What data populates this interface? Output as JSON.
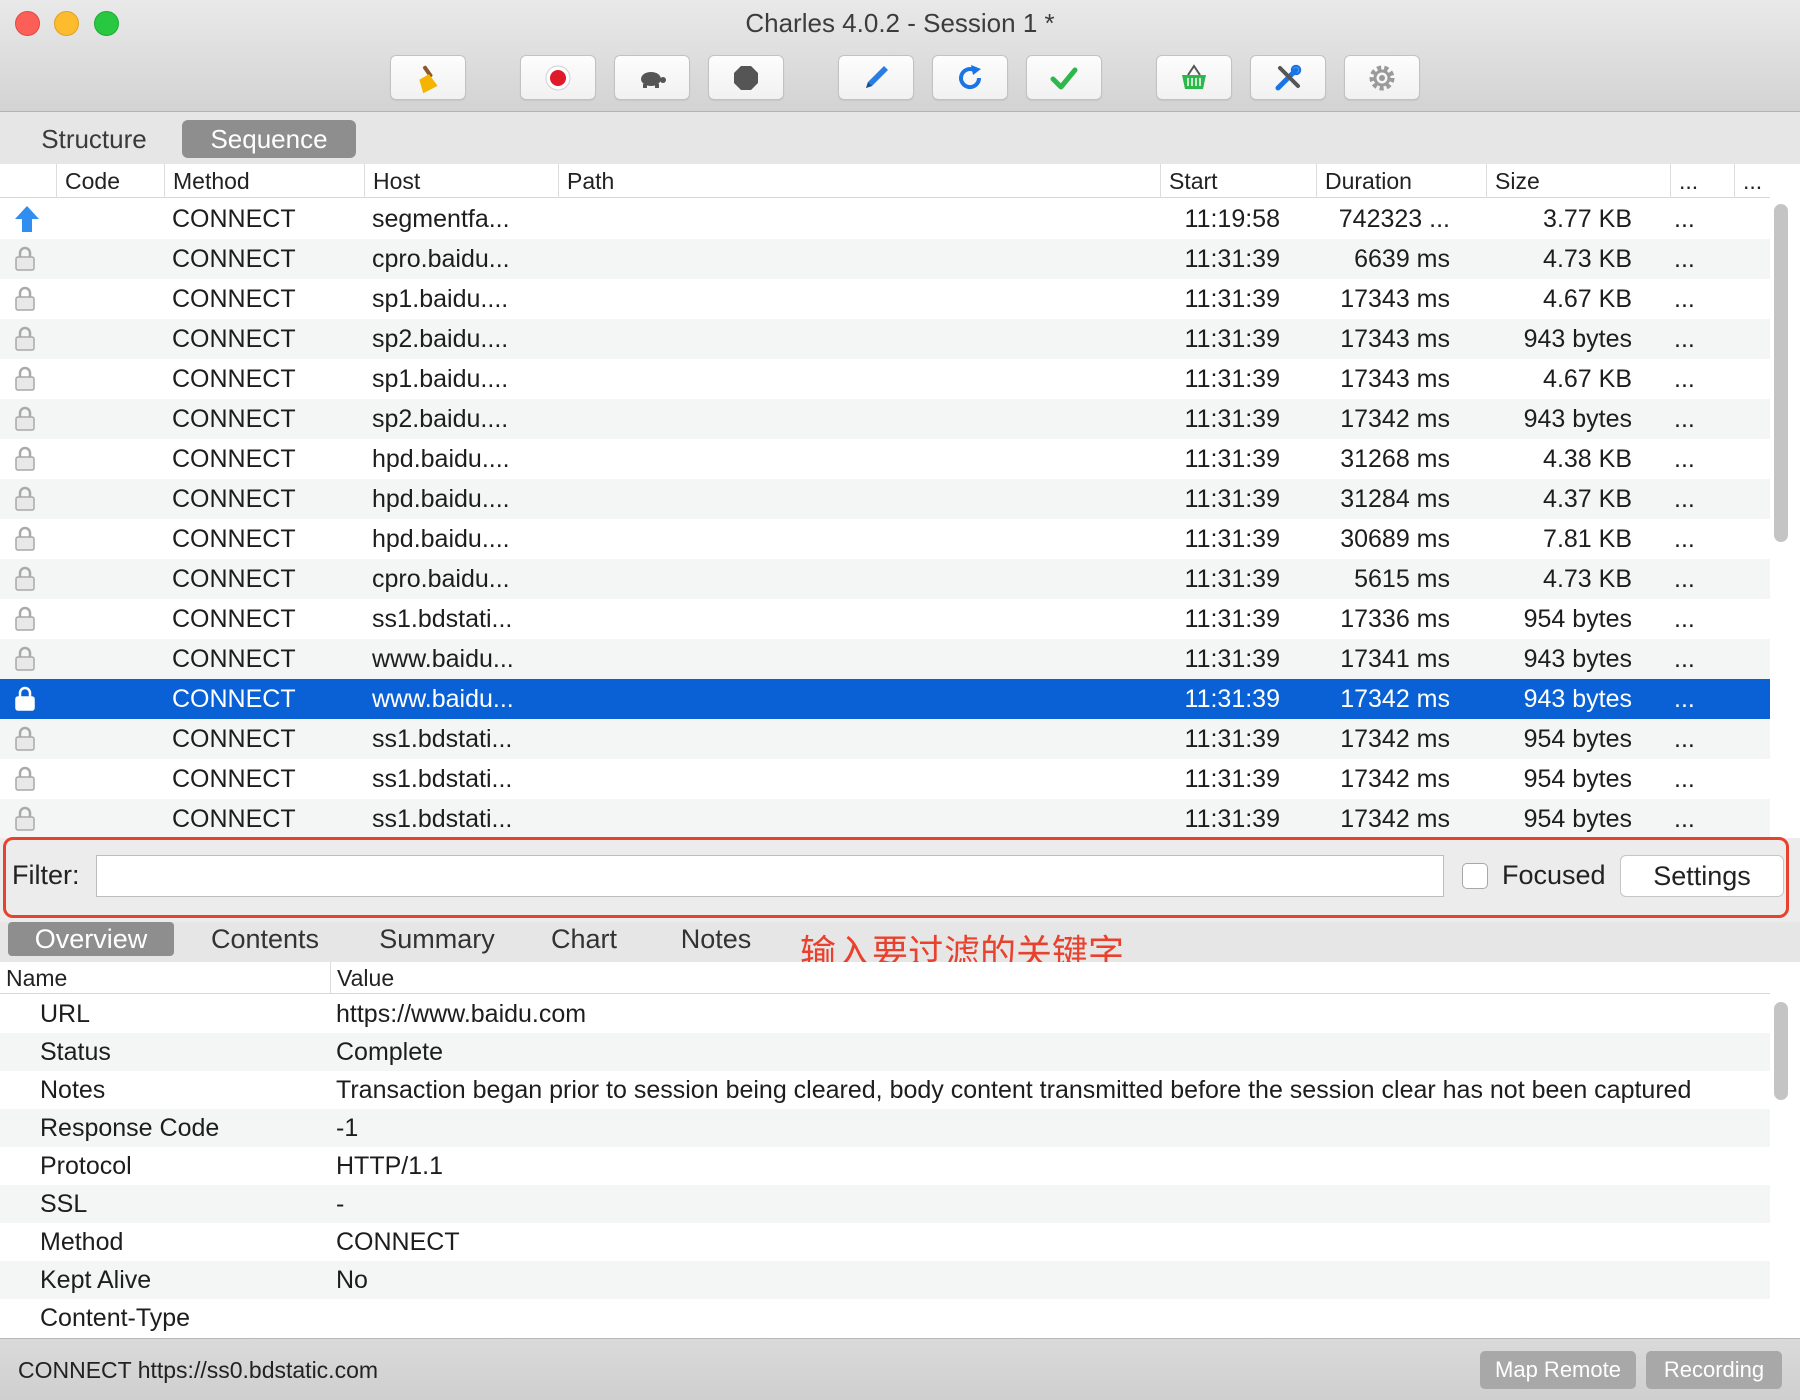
{
  "window": {
    "title": "Charles 4.0.2 - Session 1 *"
  },
  "toolbar": {
    "buttons": [
      {
        "name": "broom-icon",
        "color": "#f5b400"
      },
      {
        "name": "record-icon",
        "color": "#e11a2b"
      },
      {
        "name": "turtle-icon",
        "color": "#555555"
      },
      {
        "name": "stop-hexagon-icon",
        "color": "#555555"
      },
      {
        "name": "pen-icon",
        "color": "#2a7de1"
      },
      {
        "name": "refresh-icon",
        "color": "#1b74e4"
      },
      {
        "name": "checkmark-icon",
        "color": "#2db84c"
      },
      {
        "name": "basket-icon",
        "color": "#2db84c"
      },
      {
        "name": "tools-icon",
        "color": "#1b74e4"
      },
      {
        "name": "gear-icon",
        "color": "#9a9a9a"
      }
    ]
  },
  "view_tabs": [
    {
      "label": "Structure",
      "active": false
    },
    {
      "label": "Sequence",
      "active": true
    }
  ],
  "sequence": {
    "columns": {
      "code": "Code",
      "method": "Method",
      "host": "Host",
      "path": "Path",
      "start": "Start",
      "duration": "Duration",
      "size": "Size",
      "more1": "...",
      "more2": "..."
    },
    "rows": [
      {
        "icon": "upload-arrow",
        "method": "CONNECT",
        "host": "segmentfa...",
        "start": "11:19:58",
        "duration": "742323 ...",
        "size": "3.77 KB",
        "more": "...",
        "selected": false
      },
      {
        "icon": "lock",
        "method": "CONNECT",
        "host": "cpro.baidu...",
        "start": "11:31:39",
        "duration": "6639 ms",
        "size": "4.73 KB",
        "more": "...",
        "selected": false
      },
      {
        "icon": "lock",
        "method": "CONNECT",
        "host": "sp1.baidu....",
        "start": "11:31:39",
        "duration": "17343 ms",
        "size": "4.67 KB",
        "more": "...",
        "selected": false
      },
      {
        "icon": "lock",
        "method": "CONNECT",
        "host": "sp2.baidu....",
        "start": "11:31:39",
        "duration": "17343 ms",
        "size": "943 bytes",
        "more": "...",
        "selected": false
      },
      {
        "icon": "lock",
        "method": "CONNECT",
        "host": "sp1.baidu....",
        "start": "11:31:39",
        "duration": "17343 ms",
        "size": "4.67 KB",
        "more": "...",
        "selected": false
      },
      {
        "icon": "lock",
        "method": "CONNECT",
        "host": "sp2.baidu....",
        "start": "11:31:39",
        "duration": "17342 ms",
        "size": "943 bytes",
        "more": "...",
        "selected": false
      },
      {
        "icon": "lock",
        "method": "CONNECT",
        "host": "hpd.baidu....",
        "start": "11:31:39",
        "duration": "31268 ms",
        "size": "4.38 KB",
        "more": "...",
        "selected": false
      },
      {
        "icon": "lock",
        "method": "CONNECT",
        "host": "hpd.baidu....",
        "start": "11:31:39",
        "duration": "31284 ms",
        "size": "4.37 KB",
        "more": "...",
        "selected": false
      },
      {
        "icon": "lock",
        "method": "CONNECT",
        "host": "hpd.baidu....",
        "start": "11:31:39",
        "duration": "30689 ms",
        "size": "7.81 KB",
        "more": "...",
        "selected": false
      },
      {
        "icon": "lock",
        "method": "CONNECT",
        "host": "cpro.baidu...",
        "start": "11:31:39",
        "duration": "5615 ms",
        "size": "4.73 KB",
        "more": "...",
        "selected": false
      },
      {
        "icon": "lock",
        "method": "CONNECT",
        "host": "ss1.bdstati...",
        "start": "11:31:39",
        "duration": "17336 ms",
        "size": "954 bytes",
        "more": "...",
        "selected": false
      },
      {
        "icon": "lock",
        "method": "CONNECT",
        "host": "www.baidu...",
        "start": "11:31:39",
        "duration": "17341 ms",
        "size": "943 bytes",
        "more": "...",
        "selected": false
      },
      {
        "icon": "lock",
        "method": "CONNECT",
        "host": "www.baidu...",
        "start": "11:31:39",
        "duration": "17342 ms",
        "size": "943 bytes",
        "more": "...",
        "selected": true
      },
      {
        "icon": "lock",
        "method": "CONNECT",
        "host": "ss1.bdstati...",
        "start": "11:31:39",
        "duration": "17342 ms",
        "size": "954 bytes",
        "more": "...",
        "selected": false
      },
      {
        "icon": "lock",
        "method": "CONNECT",
        "host": "ss1.bdstati...",
        "start": "11:31:39",
        "duration": "17342 ms",
        "size": "954 bytes",
        "more": "...",
        "selected": false
      },
      {
        "icon": "lock",
        "method": "CONNECT",
        "host": "ss1.bdstati...",
        "start": "11:31:39",
        "duration": "17342 ms",
        "size": "954 bytes",
        "more": "...",
        "selected": false
      }
    ]
  },
  "filter": {
    "label": "Filter:",
    "value": "",
    "focused_label": "Focused",
    "focused_checked": false,
    "settings_label": "Settings"
  },
  "annotation": {
    "text": "输入要过滤的关键字",
    "color": "#e8422e"
  },
  "detail_tabs": [
    {
      "label": "Overview",
      "active": true
    },
    {
      "label": "Contents",
      "active": false
    },
    {
      "label": "Summary",
      "active": false
    },
    {
      "label": "Chart",
      "active": false
    },
    {
      "label": "Notes",
      "active": false
    }
  ],
  "overview": {
    "columns": {
      "name": "Name",
      "value": "Value"
    },
    "rows": [
      {
        "name": "URL",
        "value": "https://www.baidu.com"
      },
      {
        "name": "Status",
        "value": "Complete"
      },
      {
        "name": "Notes",
        "value": "Transaction began prior to session being cleared, body content transmitted before the session clear has not been captured"
      },
      {
        "name": "Response Code",
        "value": "-1"
      },
      {
        "name": "Protocol",
        "value": "HTTP/1.1"
      },
      {
        "name": "SSL",
        "value": "-"
      },
      {
        "name": "Method",
        "value": "CONNECT"
      },
      {
        "name": "Kept Alive",
        "value": "No"
      },
      {
        "name": "Content-Type",
        "value": ""
      }
    ]
  },
  "statusbar": {
    "text": "CONNECT https://ss0.bdstatic.com",
    "map_remote": "Map Remote",
    "recording": "Recording"
  },
  "colors": {
    "selection": "#0a61d6",
    "accent_red": "#e8422e"
  }
}
